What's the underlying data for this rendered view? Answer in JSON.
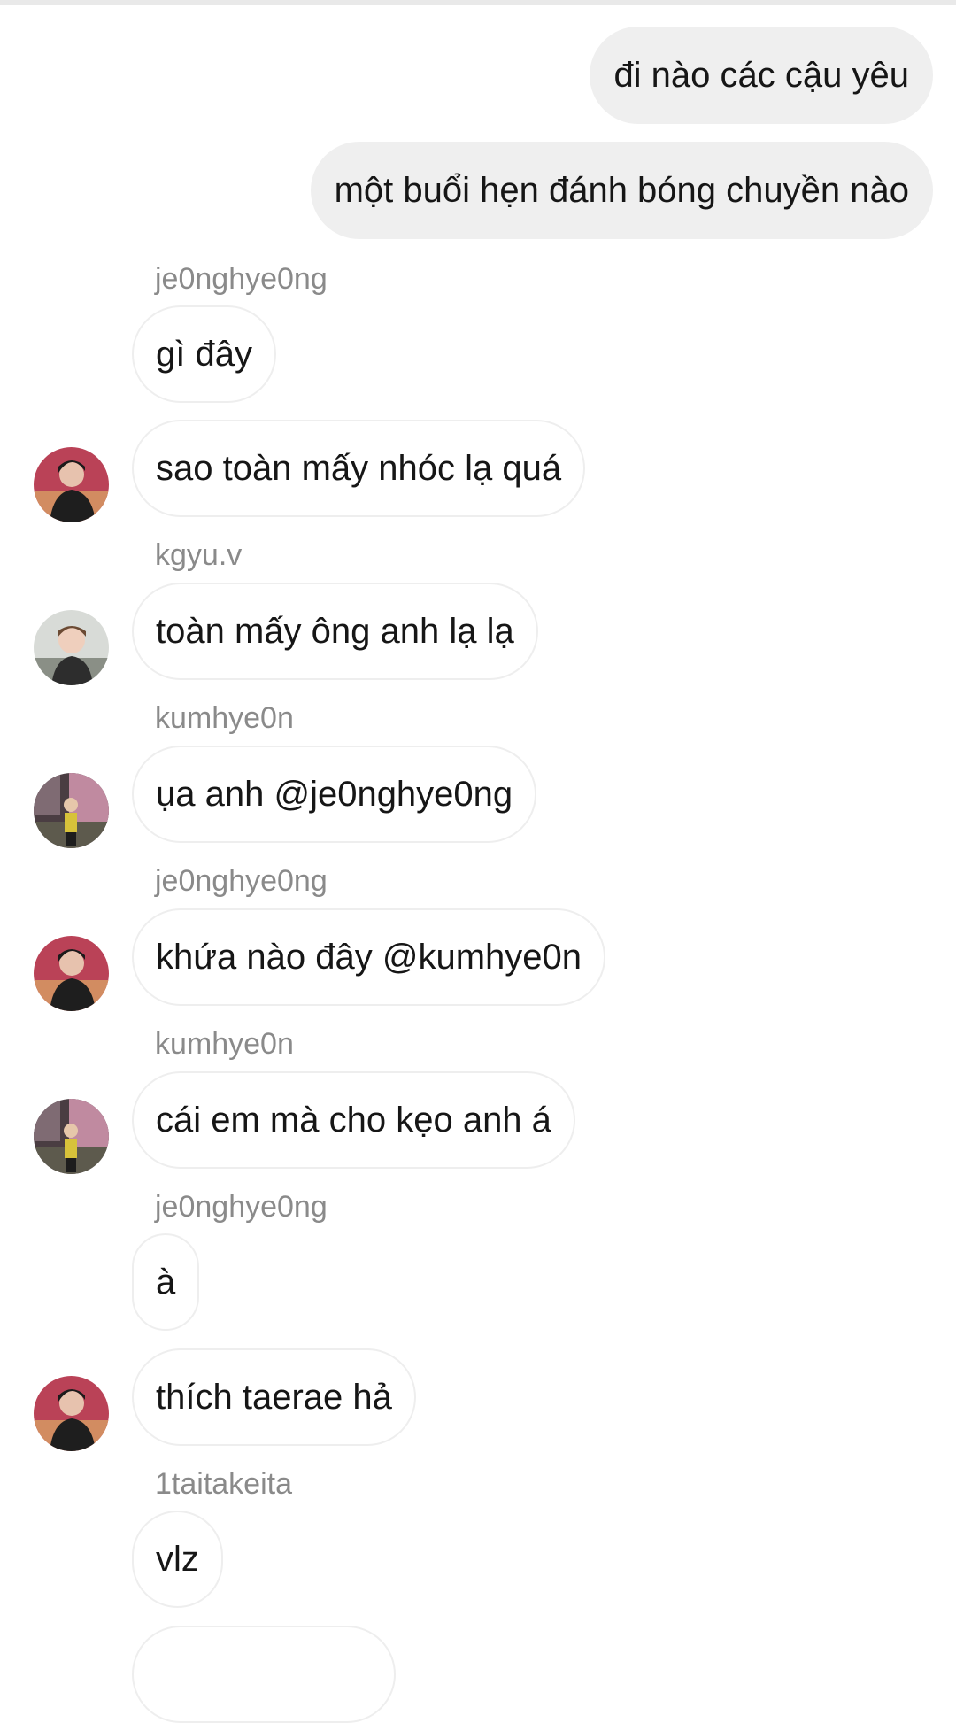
{
  "thread": {
    "messages": [
      {
        "kind": "sent",
        "text": "đi nào các cậu yêu"
      },
      {
        "kind": "sent",
        "text": "một buổi hẹn đánh bóng chuyền nào"
      },
      {
        "kind": "received",
        "sender": "je0nghye0ng",
        "text": "gì đây"
      },
      {
        "kind": "received",
        "sender": "je0nghye0ng",
        "text": "sao toàn mấy nhóc lạ quá",
        "avatar": "avatar-je0nghye0ng"
      },
      {
        "kind": "received",
        "sender": "kgyu.v",
        "text": "toàn mấy ông anh lạ lạ",
        "avatar": "avatar-kgyu-v"
      },
      {
        "kind": "received",
        "sender": "kumhye0n",
        "text": "ụa anh @je0nghye0ng",
        "avatar": "avatar-kumhye0n"
      },
      {
        "kind": "received",
        "sender": "je0nghye0ng",
        "text": "khứa nào đây @kumhye0n",
        "avatar": "avatar-je0nghye0ng"
      },
      {
        "kind": "received",
        "sender": "kumhye0n",
        "text": "cái em mà cho kẹo anh á",
        "avatar": "avatar-kumhye0n"
      },
      {
        "kind": "received",
        "sender": "je0nghye0ng",
        "text": "à"
      },
      {
        "kind": "received",
        "sender": "je0nghye0ng",
        "text": "thích taerae hả",
        "avatar": "avatar-je0nghye0ng"
      },
      {
        "kind": "received",
        "sender": "1taitakeita",
        "text": "vlz"
      }
    ]
  },
  "colors": {
    "sent_bubble": "#efefef",
    "received_border": "#eeeeee",
    "sender_name": "#8a8a8a",
    "text": "#161616"
  }
}
